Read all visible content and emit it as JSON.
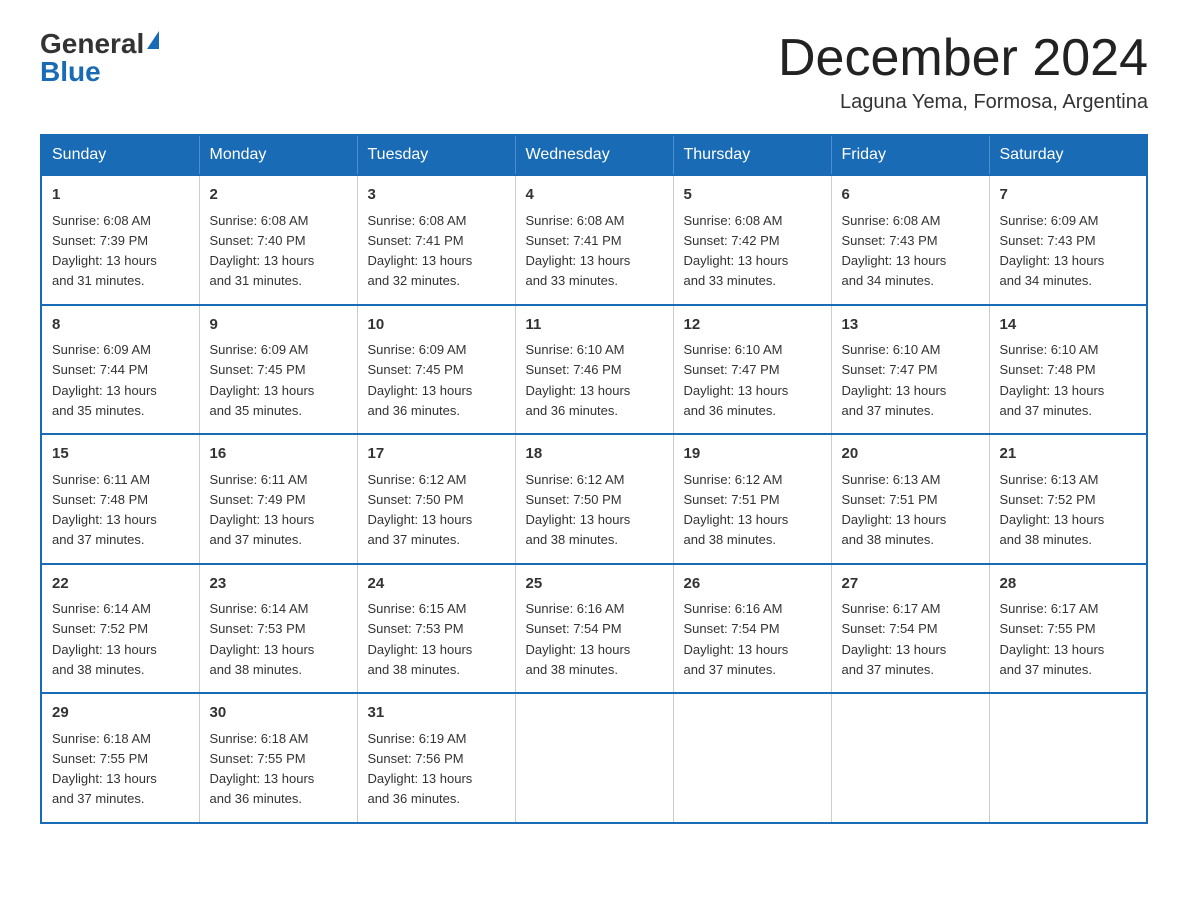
{
  "logo": {
    "general": "General",
    "blue": "Blue",
    "triangle": "▶"
  },
  "title": "December 2024",
  "location": "Laguna Yema, Formosa, Argentina",
  "days_of_week": [
    "Sunday",
    "Monday",
    "Tuesday",
    "Wednesday",
    "Thursday",
    "Friday",
    "Saturday"
  ],
  "weeks": [
    [
      {
        "day": "1",
        "sunrise": "6:08 AM",
        "sunset": "7:39 PM",
        "daylight": "13 hours and 31 minutes."
      },
      {
        "day": "2",
        "sunrise": "6:08 AM",
        "sunset": "7:40 PM",
        "daylight": "13 hours and 31 minutes."
      },
      {
        "day": "3",
        "sunrise": "6:08 AM",
        "sunset": "7:41 PM",
        "daylight": "13 hours and 32 minutes."
      },
      {
        "day": "4",
        "sunrise": "6:08 AM",
        "sunset": "7:41 PM",
        "daylight": "13 hours and 33 minutes."
      },
      {
        "day": "5",
        "sunrise": "6:08 AM",
        "sunset": "7:42 PM",
        "daylight": "13 hours and 33 minutes."
      },
      {
        "day": "6",
        "sunrise": "6:08 AM",
        "sunset": "7:43 PM",
        "daylight": "13 hours and 34 minutes."
      },
      {
        "day": "7",
        "sunrise": "6:09 AM",
        "sunset": "7:43 PM",
        "daylight": "13 hours and 34 minutes."
      }
    ],
    [
      {
        "day": "8",
        "sunrise": "6:09 AM",
        "sunset": "7:44 PM",
        "daylight": "13 hours and 35 minutes."
      },
      {
        "day": "9",
        "sunrise": "6:09 AM",
        "sunset": "7:45 PM",
        "daylight": "13 hours and 35 minutes."
      },
      {
        "day": "10",
        "sunrise": "6:09 AM",
        "sunset": "7:45 PM",
        "daylight": "13 hours and 36 minutes."
      },
      {
        "day": "11",
        "sunrise": "6:10 AM",
        "sunset": "7:46 PM",
        "daylight": "13 hours and 36 minutes."
      },
      {
        "day": "12",
        "sunrise": "6:10 AM",
        "sunset": "7:47 PM",
        "daylight": "13 hours and 36 minutes."
      },
      {
        "day": "13",
        "sunrise": "6:10 AM",
        "sunset": "7:47 PM",
        "daylight": "13 hours and 37 minutes."
      },
      {
        "day": "14",
        "sunrise": "6:10 AM",
        "sunset": "7:48 PM",
        "daylight": "13 hours and 37 minutes."
      }
    ],
    [
      {
        "day": "15",
        "sunrise": "6:11 AM",
        "sunset": "7:48 PM",
        "daylight": "13 hours and 37 minutes."
      },
      {
        "day": "16",
        "sunrise": "6:11 AM",
        "sunset": "7:49 PM",
        "daylight": "13 hours and 37 minutes."
      },
      {
        "day": "17",
        "sunrise": "6:12 AM",
        "sunset": "7:50 PM",
        "daylight": "13 hours and 37 minutes."
      },
      {
        "day": "18",
        "sunrise": "6:12 AM",
        "sunset": "7:50 PM",
        "daylight": "13 hours and 38 minutes."
      },
      {
        "day": "19",
        "sunrise": "6:12 AM",
        "sunset": "7:51 PM",
        "daylight": "13 hours and 38 minutes."
      },
      {
        "day": "20",
        "sunrise": "6:13 AM",
        "sunset": "7:51 PM",
        "daylight": "13 hours and 38 minutes."
      },
      {
        "day": "21",
        "sunrise": "6:13 AM",
        "sunset": "7:52 PM",
        "daylight": "13 hours and 38 minutes."
      }
    ],
    [
      {
        "day": "22",
        "sunrise": "6:14 AM",
        "sunset": "7:52 PM",
        "daylight": "13 hours and 38 minutes."
      },
      {
        "day": "23",
        "sunrise": "6:14 AM",
        "sunset": "7:53 PM",
        "daylight": "13 hours and 38 minutes."
      },
      {
        "day": "24",
        "sunrise": "6:15 AM",
        "sunset": "7:53 PM",
        "daylight": "13 hours and 38 minutes."
      },
      {
        "day": "25",
        "sunrise": "6:16 AM",
        "sunset": "7:54 PM",
        "daylight": "13 hours and 38 minutes."
      },
      {
        "day": "26",
        "sunrise": "6:16 AM",
        "sunset": "7:54 PM",
        "daylight": "13 hours and 37 minutes."
      },
      {
        "day": "27",
        "sunrise": "6:17 AM",
        "sunset": "7:54 PM",
        "daylight": "13 hours and 37 minutes."
      },
      {
        "day": "28",
        "sunrise": "6:17 AM",
        "sunset": "7:55 PM",
        "daylight": "13 hours and 37 minutes."
      }
    ],
    [
      {
        "day": "29",
        "sunrise": "6:18 AM",
        "sunset": "7:55 PM",
        "daylight": "13 hours and 37 minutes."
      },
      {
        "day": "30",
        "sunrise": "6:18 AM",
        "sunset": "7:55 PM",
        "daylight": "13 hours and 36 minutes."
      },
      {
        "day": "31",
        "sunrise": "6:19 AM",
        "sunset": "7:56 PM",
        "daylight": "13 hours and 36 minutes."
      },
      null,
      null,
      null,
      null
    ]
  ],
  "labels": {
    "sunrise": "Sunrise:",
    "sunset": "Sunset:",
    "daylight": "Daylight:"
  }
}
